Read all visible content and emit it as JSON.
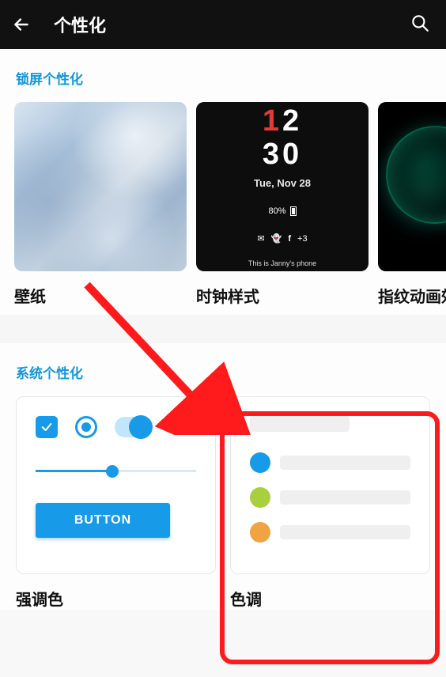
{
  "header": {
    "title": "个性化"
  },
  "sections": {
    "lock": {
      "title": "锁屏个性化",
      "cards": {
        "wallpaper": {
          "label": "壁纸"
        },
        "clock": {
          "label": "时钟样式",
          "time_h": "12",
          "time_m": "30",
          "date": "Tue, Nov 28",
          "battery": "80%",
          "notif_extra": "+3",
          "footer": "This is Janny's phone"
        },
        "fingerprint": {
          "label": "指纹动画效"
        }
      }
    },
    "system": {
      "title": "系统个性化",
      "accent": {
        "label": "强调色",
        "button": "BUTTON"
      },
      "tone": {
        "label": "色调",
        "dots": [
          "#179be8",
          "#a8cf3f",
          "#f0a342"
        ]
      }
    }
  }
}
